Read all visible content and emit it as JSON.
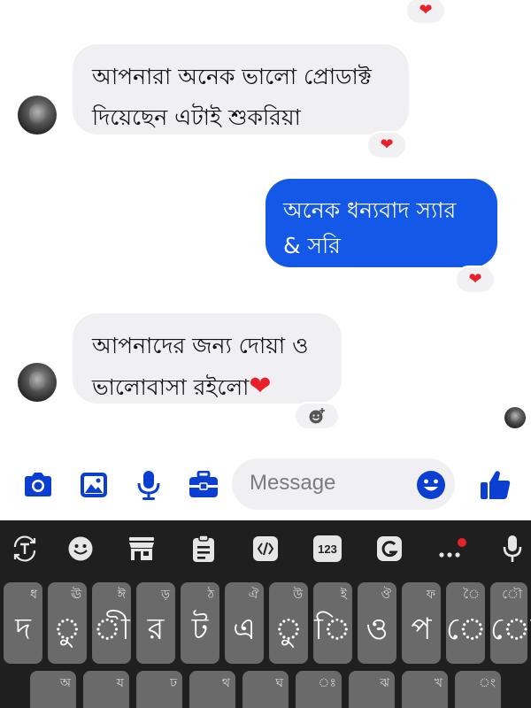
{
  "messages": {
    "m1_line1": "আপনারা অনেক ভালো প্রোডাক্ট",
    "m1_line2": "দিয়েছেন এটাই শুকরিয়া",
    "m2_line1": "অনেক ধন্যবাদ স্যার",
    "m2_line2": "& সরি",
    "m3_line1": "আপনাদের জন্য দোয়া ও",
    "m3_line2": "ভালোবাসা রইলো",
    "m3_emoji": "❤"
  },
  "reactions": {
    "heart": "❤"
  },
  "composer": {
    "placeholder": "Message",
    "icons": [
      "camera-icon",
      "gallery-icon",
      "microphone-icon",
      "toolbox-icon",
      "emoji-icon",
      "thumbs-up-icon"
    ]
  },
  "keyboard": {
    "toolbar": {
      "num_label": "123"
    },
    "row1": [
      {
        "main": "দ",
        "hint": "ধ"
      },
      {
        "main": "ু",
        "hint": "ঊ"
      },
      {
        "main": "ী",
        "hint": "ঈ"
      },
      {
        "main": "র",
        "hint": "ড়"
      },
      {
        "main": "ট",
        "hint": "ঠ"
      },
      {
        "main": "এ",
        "hint": "ঐ"
      },
      {
        "main": "ু",
        "hint": "উ"
      },
      {
        "main": "ি",
        "hint": "ই"
      },
      {
        "main": "ও",
        "hint": "ঔ"
      },
      {
        "main": "প",
        "hint": "ফ"
      },
      {
        "main": "ে",
        "hint": "ৈ"
      },
      {
        "main": "ো",
        "hint": "ৌ"
      }
    ],
    "row2_hints": [
      "অ",
      "য",
      "ঢ",
      "থ",
      "ঘ",
      "ঃ",
      "ঝ",
      "খ",
      "ং"
    ]
  },
  "colors": {
    "outgoing": "#1358e6",
    "accent": "#0a3fd1",
    "incoming": "#f0f0f2",
    "heart": "#e8202a",
    "keyboard_bg": "#1f1f1f",
    "key_bg": "#6a6a6a"
  }
}
